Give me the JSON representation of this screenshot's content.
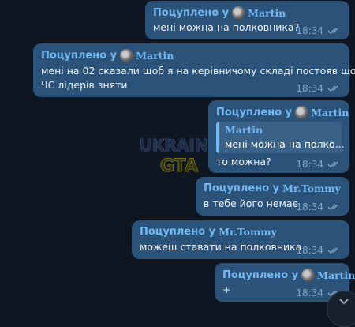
{
  "forward_prefix": "Поцуплено у",
  "messages": [
    {
      "sender": "Martin",
      "text": "мені можна на полковника?",
      "time": "18:34"
    },
    {
      "sender": "Martin",
      "text_lines": [
        "мені на 02 сказали щоб я на керівничому складі постояв щоб",
        "ЧС лідерів зняти"
      ],
      "time": "18:34"
    },
    {
      "sender": "Martin",
      "reply_to": {
        "sender": "Martin",
        "text": "мені можна на полко..."
      },
      "text": "то можна?",
      "time": "18:34"
    },
    {
      "sender": "Mr.Tommy",
      "text": "в тебе його немає",
      "time": "18:34"
    },
    {
      "sender": "Mr.Tommy",
      "text": "можеш ставати на полковника",
      "time": "18:34"
    },
    {
      "sender": "Martin",
      "text": "+",
      "time": "18:34"
    }
  ],
  "watermark": {
    "line1": "UKRAINE",
    "line2": "GTA"
  },
  "colors": {
    "bubble": "#2b5278",
    "background": "#0e1621",
    "accent": "#72b8f2",
    "meta": "#7fa6c7"
  },
  "icons": {
    "read_status": "double-check-icon",
    "scroll_down": "chevron-down-icon"
  }
}
